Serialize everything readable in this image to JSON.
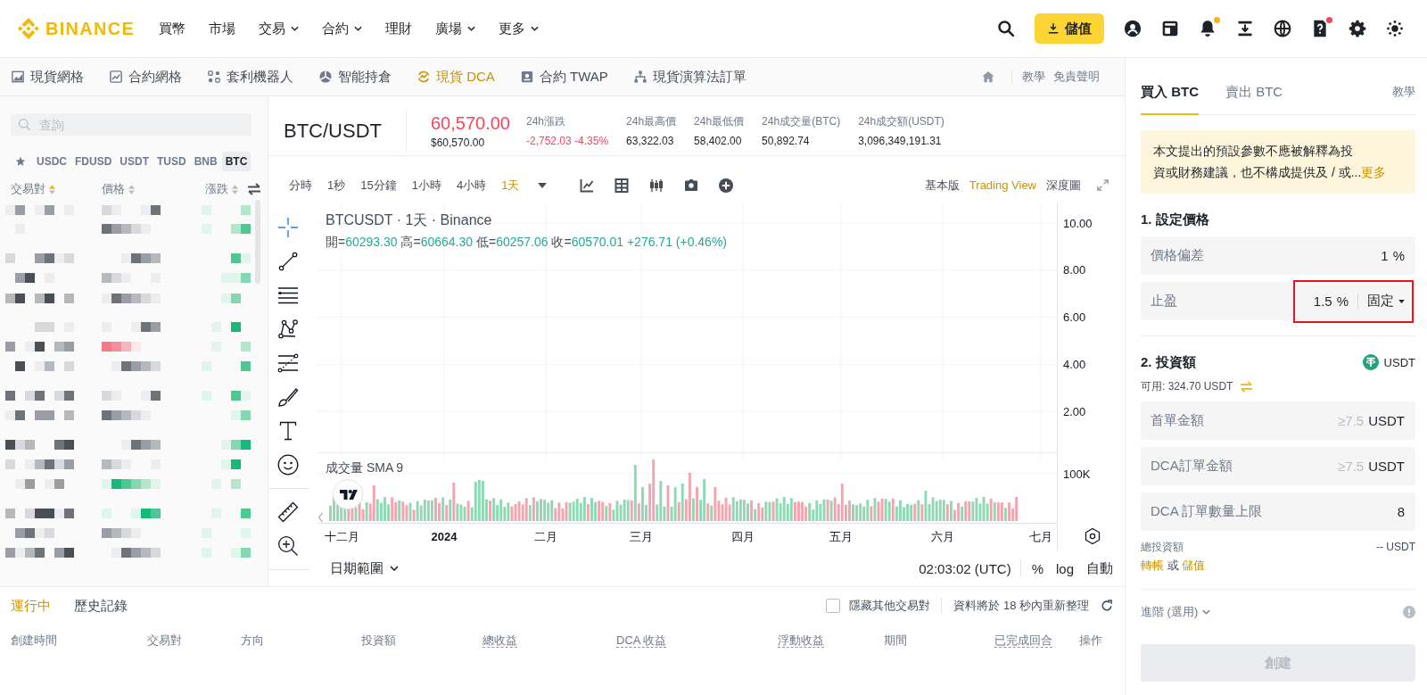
{
  "header": {
    "logo": "BINANCE",
    "nav": [
      {
        "label": "買幣",
        "menu": false
      },
      {
        "label": "市場",
        "menu": false
      },
      {
        "label": "交易",
        "menu": true
      },
      {
        "label": "合約",
        "menu": true
      },
      {
        "label": "理財",
        "menu": false
      },
      {
        "label": "廣場",
        "menu": true
      },
      {
        "label": "更多",
        "menu": true
      }
    ],
    "actions": [
      {
        "kind": "search"
      },
      {
        "kind": "deposit",
        "label": "儲值"
      },
      {
        "kind": "account"
      },
      {
        "kind": "orders"
      },
      {
        "kind": "bell",
        "color": "#f0b90b"
      },
      {
        "kind": "download"
      },
      {
        "kind": "globe"
      },
      {
        "kind": "help",
        "color": "#f6465d"
      },
      {
        "kind": "settings"
      },
      {
        "kind": "theme"
      }
    ]
  },
  "strategy_bar": {
    "tabs": [
      {
        "kind": "spot-grid",
        "label": "現貨網格",
        "selected": false
      },
      {
        "kind": "futures-grid",
        "label": "合約網格",
        "selected": false
      },
      {
        "kind": "arbitrage",
        "label": "套利機器人",
        "selected": false
      },
      {
        "kind": "rebalance",
        "label": "智能持倉",
        "selected": false
      },
      {
        "kind": "dca",
        "label": "現貨 DCA",
        "selected": true
      },
      {
        "kind": "twap",
        "label": "合約 TWAP",
        "selected": false
      },
      {
        "kind": "algo",
        "label": "現貨演算法訂單",
        "selected": false
      }
    ],
    "links": [
      "教學",
      "免責聲明"
    ]
  },
  "pair_list": {
    "search": {
      "placeholder": "查詢"
    },
    "quotes": [
      {
        "label": "USDC",
        "selected": false
      },
      {
        "label": "FDUSD",
        "selected": false
      },
      {
        "label": "USDT",
        "selected": false
      },
      {
        "label": "TUSD",
        "selected": false
      },
      {
        "label": "BNB",
        "selected": false
      },
      {
        "label": "BTC",
        "selected": true
      }
    ],
    "columns": [
      {
        "label": "交易對",
        "sorted": true
      },
      {
        "label": "價格",
        "sorted": false
      },
      {
        "label": "漲跌",
        "sorted": false
      }
    ]
  },
  "ticker": {
    "symbol": "BTC/USDT",
    "price": "60,570.00",
    "falling": true,
    "price_usd": "$60,570.00",
    "stats": [
      {
        "label": "24h漲跌",
        "value": "-2,752.03 -4.35%",
        "falling": true
      },
      {
        "label": "24h最高價",
        "value": "63,322.03",
        "falling": false
      },
      {
        "label": "24h最低價",
        "value": "58,402.00",
        "falling": false
      },
      {
        "label": "24h成交量(BTC)",
        "value": "50,892.74",
        "falling": false
      },
      {
        "label": "24h成交額(USDT)",
        "value": "3,096,349,191.31",
        "falling": false
      }
    ]
  },
  "chart_toolbar": {
    "intervals": [
      {
        "label": "分時",
        "selected": false
      },
      {
        "label": "1秒",
        "selected": false
      },
      {
        "label": "15分鐘",
        "selected": false
      },
      {
        "label": "1小時",
        "selected": false
      },
      {
        "label": "4小時",
        "selected": false
      },
      {
        "label": "1天",
        "selected": true
      }
    ],
    "views": [
      {
        "label": "基本版",
        "selected": false
      },
      {
        "label": "Trading View",
        "selected": true
      },
      {
        "label": "深度圖",
        "selected": false
      }
    ]
  },
  "chart": {
    "title": "BTCUSDT · 1天 · Binance",
    "ohlc": [
      {
        "label": "開=",
        "value": "60293.30"
      },
      {
        "label": "高=",
        "value": "60664.30"
      },
      {
        "label": "低=",
        "value": "60257.06"
      },
      {
        "label": "收=",
        "value": "60570.01"
      }
    ],
    "change": "+276.71 (+0.46%)",
    "price_ticks": [
      "10.00",
      "8.00",
      "6.00",
      "4.00",
      "2.00"
    ],
    "volume_title": "成交量 SMA 9",
    "volume_tick": "100K",
    "time_ticks": [
      {
        "label": "十二月",
        "kind": "month"
      },
      {
        "label": "2024",
        "kind": "year"
      },
      {
        "label": "二月",
        "kind": "month"
      },
      {
        "label": "三月",
        "kind": "month"
      },
      {
        "label": "四月",
        "kind": "month"
      },
      {
        "label": "五月",
        "kind": "month"
      },
      {
        "label": "六月",
        "kind": "month"
      },
      {
        "label": "七月",
        "kind": "month"
      }
    ]
  },
  "chart_footer": {
    "range": "日期範圍",
    "clock": "02:03:02 (UTC)",
    "scales": [
      "%",
      "log",
      "自動"
    ]
  },
  "orders": {
    "tabs": [
      {
        "label": "運行中",
        "selected": true
      },
      {
        "label": "歷史記錄",
        "selected": false
      }
    ],
    "hide_others": {
      "label": "隱藏其他交易對",
      "checked": false
    },
    "refresh_note": "資料將於 18 秒內重新整理",
    "columns": [
      {
        "label": "創建時間",
        "tooltip": false
      },
      {
        "label": "交易對",
        "tooltip": false
      },
      {
        "label": "方向",
        "tooltip": false
      },
      {
        "label": "投資額",
        "tooltip": false
      },
      {
        "label": "總收益",
        "tooltip": true
      },
      {
        "label": "DCA 收益",
        "tooltip": true
      },
      {
        "label": "浮動收益",
        "tooltip": true
      },
      {
        "label": "期間",
        "tooltip": false
      },
      {
        "label": "已完成回合",
        "tooltip": true
      },
      {
        "label": "操作",
        "tooltip": false
      }
    ]
  },
  "order_panel": {
    "tabs": [
      {
        "label": "買入 BTC",
        "selected": true
      },
      {
        "label": "賣出 BTC",
        "selected": false
      }
    ],
    "tutorial": "教學",
    "notice": {
      "lines": [
        "本文提出的預設參數不應被解釋為投",
        "資或財務建議，也不構成提供及 / 或..."
      ],
      "more": "更多"
    },
    "price_section": {
      "title": "1. 設定價格",
      "fields": [
        {
          "label": "價格偏差",
          "value": "1",
          "unit": "%"
        },
        {
          "label": "止盈",
          "value": "1.5",
          "unit": "%",
          "mode": "固定",
          "highlighted": true
        }
      ]
    },
    "investment_section": {
      "title": "2. 投資額",
      "currency": "USDT",
      "available": "可用: 324.70 USDT",
      "fields": [
        {
          "label": "首單金額",
          "placeholder": "≥7.5",
          "unit": "USDT"
        },
        {
          "label": "DCA訂單金額",
          "placeholder": "≥7.5",
          "unit": "USDT"
        },
        {
          "label": "DCA 訂單數量上限",
          "value": "8"
        }
      ],
      "total_label": "總投資額",
      "total_value": "-- USDT",
      "funding": {
        "transfer": "轉帳",
        "or": "或",
        "deposit": "儲值"
      }
    },
    "advanced": "進階 (選用)",
    "create_button": {
      "label": "創建",
      "disabled": true
    }
  }
}
